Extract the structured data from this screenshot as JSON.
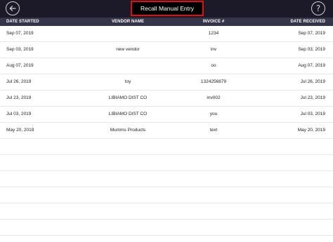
{
  "header": {
    "title": "Recall Manual Entry",
    "back_icon": "arrow-left-icon",
    "help_icon": "question-mark-icon",
    "help_glyph": "?"
  },
  "columns": {
    "date_started": "DATE STARTED",
    "vendor_name": "VENDOR NAME",
    "invoice": "INVOICE #",
    "date_received": "DATE RECEIVED"
  },
  "rows": [
    {
      "date_started": "Sep 07, 2019",
      "vendor_name": "",
      "invoice": "1234",
      "date_received": "Sep 07, 2019"
    },
    {
      "date_started": "Sep 03, 2019",
      "vendor_name": "new vendor",
      "invoice": "inv",
      "date_received": "Sep 03, 2019"
    },
    {
      "date_started": "Aug 07, 2019",
      "vendor_name": "",
      "invoice": "oo",
      "date_received": "Aug 07, 2019"
    },
    {
      "date_started": "Jul 26, 2019",
      "vendor_name": "toy",
      "invoice": "1324256879",
      "date_received": "Jul 26, 2019"
    },
    {
      "date_started": "Jul 23, 2019",
      "vendor_name": "LIBIAMO DIST CO",
      "invoice": "inv002",
      "date_received": "Jul 23, 2019"
    },
    {
      "date_started": "Jul 03, 2019",
      "vendor_name": "LIBIAMO DIST CO",
      "invoice": "you",
      "date_received": "Jul 03, 2019"
    },
    {
      "date_started": "May 20, 2019",
      "vendor_name": "Mumms Products",
      "invoice": "text",
      "date_received": "May 20, 2019"
    },
    {
      "date_started": "",
      "vendor_name": "",
      "invoice": "",
      "date_received": ""
    },
    {
      "date_started": "",
      "vendor_name": "",
      "invoice": "",
      "date_received": ""
    },
    {
      "date_started": "",
      "vendor_name": "",
      "invoice": "",
      "date_received": ""
    },
    {
      "date_started": "",
      "vendor_name": "",
      "invoice": "",
      "date_received": ""
    },
    {
      "date_started": "",
      "vendor_name": "",
      "invoice": "",
      "date_received": ""
    },
    {
      "date_started": "",
      "vendor_name": "",
      "invoice": "",
      "date_received": ""
    }
  ],
  "colors": {
    "topbar": "#1c1a28",
    "column_header": "#35354a",
    "title_border": "#e01010"
  }
}
